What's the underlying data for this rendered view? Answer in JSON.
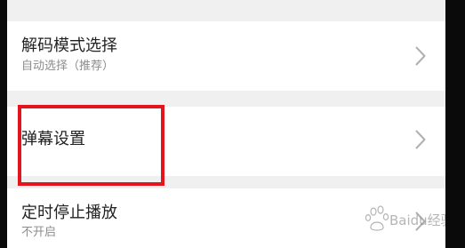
{
  "settings": {
    "items": [
      {
        "title": "解码模式选择",
        "subtitle": "自动选择（推荐）",
        "icon": "chevron-right-icon"
      },
      {
        "title": "弹幕设置",
        "subtitle": "",
        "icon": "chevron-right-icon"
      },
      {
        "title": "定时停止播放",
        "subtitle": "不开启",
        "icon": "chevron-right-icon"
      }
    ]
  },
  "annotation": {
    "highlight_color": "#e3141b"
  },
  "watermark": {
    "text": "Baidu经验"
  },
  "colors": {
    "background": "#f0f0f0",
    "row": "#ffffff",
    "title_text": "#222222",
    "subtitle_text": "#8c8c8c",
    "chevron": "#b0b0b0"
  }
}
